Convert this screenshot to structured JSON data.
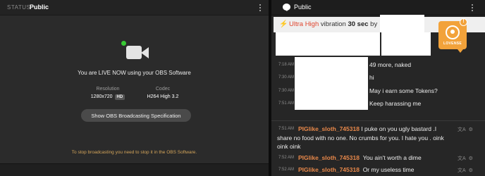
{
  "broadcast": {
    "status_label": "STATUS",
    "status_value": "Public",
    "live_message": "You are LIVE NOW using your OBS Software",
    "resolution_label": "Resolution",
    "resolution_value": "1280x720",
    "hd_badge": "HD",
    "codec_label": "Codec",
    "codec_value": "H264 High 3.2",
    "spec_button": "Show OBS Broadcasting Specification",
    "stop_note": "To stop broadcasting you need to stop it in the OBS Software.",
    "live_indicator_color": "#38c934"
  },
  "chat": {
    "title": "Public",
    "title_icon": "chat-bubble-icon",
    "tip": {
      "level": "Ultra High",
      "action": "vibration",
      "duration": "30 sec",
      "by": "by"
    },
    "lovense": {
      "label": "LOVENSE",
      "alert": "!"
    },
    "messages": [
      {
        "time": "7:18 AM",
        "user": "",
        "text": "49 more, naked"
      },
      {
        "time": "7:30 AM",
        "user": "",
        "text": "hi"
      },
      {
        "time": "7:30 AM",
        "user": "",
        "text": "May i earn some Tokens?"
      },
      {
        "time": "7:51 AM",
        "user": "",
        "text": "Keep harassing me"
      },
      {
        "time": "7:51 AM",
        "user": "PIGlike_sloth_745318",
        "text": "I puke on you ugly bastard .I",
        "cont1": "share no food with no one. No crumbs for you. I hate you . oink",
        "cont2": "oink oink"
      },
      {
        "time": "7:52 AM",
        "user": "PIGlike_sloth_745318",
        "text": "You ain't worth a dime"
      },
      {
        "time": "7:52 AM",
        "user": "PIGlike_sloth_745318",
        "text": "Or my useless time"
      }
    ],
    "username_color": "#e8884a",
    "tip_level_color": "#e0452e",
    "accent_color": "#f2a23a"
  }
}
